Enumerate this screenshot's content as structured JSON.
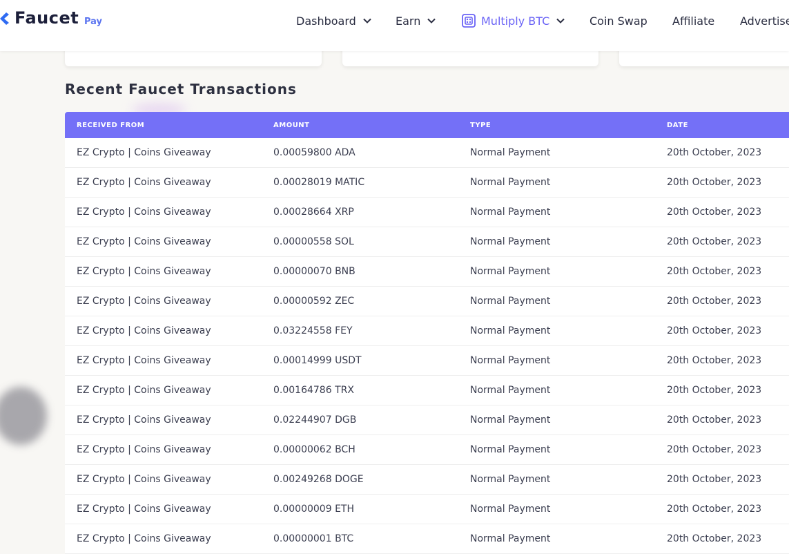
{
  "brand": {
    "name": "Faucet",
    "suffix": "Pay",
    "colors": {
      "primary": "#6a63f6",
      "dark": "#1c1f3a",
      "header_bg": "#7470f7"
    }
  },
  "nav": {
    "items": [
      {
        "label": "Dashboard",
        "dropdown": true
      },
      {
        "label": "Earn",
        "dropdown": true
      },
      {
        "label": "Multiply BTC",
        "dropdown": true,
        "active": true,
        "icon": "dice-icon"
      },
      {
        "label": "Coin Swap",
        "dropdown": false
      },
      {
        "label": "Affiliate",
        "dropdown": false
      },
      {
        "label": "Advertise",
        "dropdown": false
      }
    ]
  },
  "section": {
    "title": "Recent Faucet Transactions"
  },
  "table": {
    "columns": [
      "RECEIVED FROM",
      "AMOUNT",
      "TYPE",
      "DATE"
    ],
    "rows": [
      [
        "EZ Crypto | Coins Giveaway",
        "0.00059800 ADA",
        "Normal Payment",
        "20th October, 2023"
      ],
      [
        "EZ Crypto | Coins Giveaway",
        "0.00028019 MATIC",
        "Normal Payment",
        "20th October, 2023"
      ],
      [
        "EZ Crypto | Coins Giveaway",
        "0.00028664 XRP",
        "Normal Payment",
        "20th October, 2023"
      ],
      [
        "EZ Crypto | Coins Giveaway",
        "0.00000558 SOL",
        "Normal Payment",
        "20th October, 2023"
      ],
      [
        "EZ Crypto | Coins Giveaway",
        "0.00000070 BNB",
        "Normal Payment",
        "20th October, 2023"
      ],
      [
        "EZ Crypto | Coins Giveaway",
        "0.00000592 ZEC",
        "Normal Payment",
        "20th October, 2023"
      ],
      [
        "EZ Crypto | Coins Giveaway",
        "0.03224558 FEY",
        "Normal Payment",
        "20th October, 2023"
      ],
      [
        "EZ Crypto | Coins Giveaway",
        "0.00014999 USDT",
        "Normal Payment",
        "20th October, 2023"
      ],
      [
        "EZ Crypto | Coins Giveaway",
        "0.00164786 TRX",
        "Normal Payment",
        "20th October, 2023"
      ],
      [
        "EZ Crypto | Coins Giveaway",
        "0.02244907 DGB",
        "Normal Payment",
        "20th October, 2023"
      ],
      [
        "EZ Crypto | Coins Giveaway",
        "0.00000062 BCH",
        "Normal Payment",
        "20th October, 2023"
      ],
      [
        "EZ Crypto | Coins Giveaway",
        "0.00249268 DOGE",
        "Normal Payment",
        "20th October, 2023"
      ],
      [
        "EZ Crypto | Coins Giveaway",
        "0.00000009 ETH",
        "Normal Payment",
        "20th October, 2023"
      ],
      [
        "EZ Crypto | Coins Giveaway",
        "0.00000001 BTC",
        "Normal Payment",
        "20th October, 2023"
      ]
    ]
  }
}
